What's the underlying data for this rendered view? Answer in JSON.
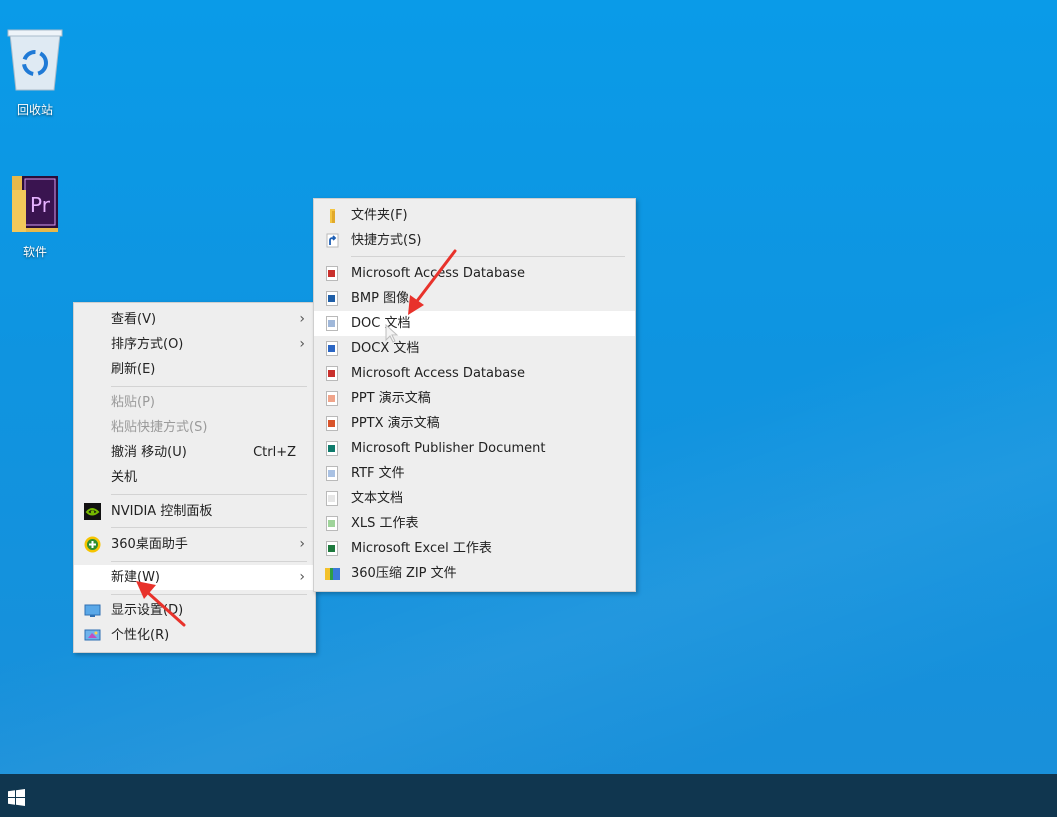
{
  "desktop": {
    "icons": [
      {
        "label": "回收站",
        "icon": "recycle-bin-icon"
      },
      {
        "label": "软件",
        "icon": "premiere-folder-icon"
      }
    ]
  },
  "context_menu": {
    "items": [
      {
        "label": "查看(V)",
        "submenu": true
      },
      {
        "label": "排序方式(O)",
        "submenu": true
      },
      {
        "label": "刷新(E)"
      },
      {
        "label": "粘贴(P)",
        "disabled": true
      },
      {
        "label": "粘贴快捷方式(S)",
        "disabled": true
      },
      {
        "label": "撤消 移动(U)",
        "shortcut": "Ctrl+Z"
      },
      {
        "label": "关机"
      },
      {
        "label": "NVIDIA 控制面板",
        "icon": "nvidia-icon"
      },
      {
        "label": "360桌面助手",
        "icon": "360-icon",
        "submenu": true
      },
      {
        "label": "新建(W)",
        "submenu": true,
        "highlighted": true
      },
      {
        "label": "显示设置(D)",
        "icon": "display-settings-icon"
      },
      {
        "label": "个性化(R)",
        "icon": "personalize-icon"
      }
    ]
  },
  "new_submenu": {
    "items": [
      {
        "label": "文件夹(F)",
        "icon": "folder-icon"
      },
      {
        "label": "快捷方式(S)",
        "icon": "shortcut-icon"
      },
      {
        "label": "Microsoft Access Database",
        "icon": "access-icon"
      },
      {
        "label": "BMP 图像",
        "icon": "bmp-icon"
      },
      {
        "label": "DOC 文档",
        "icon": "doc-icon",
        "highlighted": true
      },
      {
        "label": "DOCX 文档",
        "icon": "docx-icon"
      },
      {
        "label": "Microsoft Access Database",
        "icon": "access-icon"
      },
      {
        "label": "PPT 演示文稿",
        "icon": "ppt-icon"
      },
      {
        "label": "PPTX 演示文稿",
        "icon": "pptx-icon"
      },
      {
        "label": "Microsoft Publisher Document",
        "icon": "publisher-icon"
      },
      {
        "label": "RTF 文件",
        "icon": "rtf-icon"
      },
      {
        "label": "文本文档",
        "icon": "text-document-icon"
      },
      {
        "label": "XLS 工作表",
        "icon": "xls-icon"
      },
      {
        "label": "Microsoft Excel 工作表",
        "icon": "excel-icon"
      },
      {
        "label": "360压缩 ZIP 文件",
        "icon": "zip-icon"
      }
    ]
  },
  "colors": {
    "desktop": "#0a9be8",
    "taskbar": "#10364f",
    "menu_bg": "#eeeeee",
    "highlight": "#ffffff",
    "annotation_arrow": "#e8322b"
  }
}
